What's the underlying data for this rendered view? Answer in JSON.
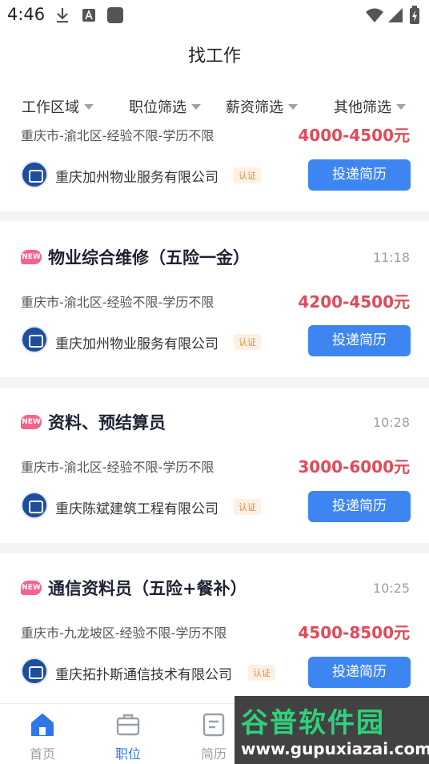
{
  "status_bar": {
    "time": "4:46"
  },
  "header": {
    "title": "找工作"
  },
  "filters": [
    "工作区域",
    "职位筛选",
    "薪资筛选",
    "其他筛选"
  ],
  "jobs": [
    {
      "title": "",
      "time": "",
      "info": "重庆市-渝北区-经验不限-学历不限",
      "salary": "4000-4500元",
      "company": "重庆加州物业服务有限公司",
      "cert": "认证",
      "apply": "投递简历"
    },
    {
      "badge": "NEW",
      "title": "物业综合维修（五险一金）",
      "time": "11:18",
      "info": "重庆市-渝北区-经验不限-学历不限",
      "salary": "4200-4500元",
      "company": "重庆加州物业服务有限公司",
      "cert": "认证",
      "apply": "投递简历"
    },
    {
      "badge": "NEW",
      "title": "资料、预结算员",
      "time": "10:28",
      "info": "重庆市-渝北区-经验不限-学历不限",
      "salary": "3000-6000元",
      "company": "重庆陈斌建筑工程有限公司",
      "cert": "认证",
      "apply": "投递简历"
    },
    {
      "badge": "NEW",
      "title": "通信资料员（五险+餐补）",
      "time": "10:25",
      "info": "重庆市-九龙坡区-经验不限-学历不限",
      "salary": "4500-8500元",
      "company": "重庆拓扑斯通信技术有限公司",
      "cert": "认证",
      "apply": "投递简历"
    }
  ],
  "tabs": [
    "首页",
    "职位",
    "简历"
  ],
  "watermark": {
    "main": "谷普软件园",
    "sub": "www.gupuxiazai.com"
  },
  "colors": {
    "accent": "#3d86f2",
    "salary": "#e04a59",
    "new_badge": "#f7628b"
  }
}
